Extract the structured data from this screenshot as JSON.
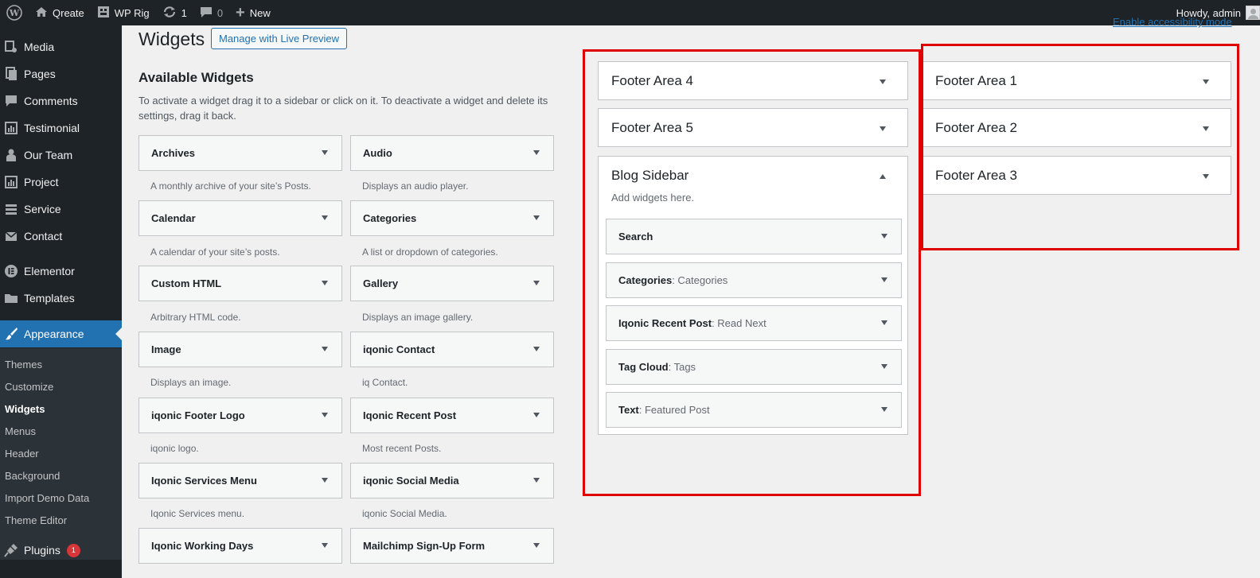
{
  "adminbar": {
    "site_name": "Qreate",
    "theme_name": "WP Rig",
    "updates_count": "1",
    "comments_count": "0",
    "new_label": "New",
    "howdy": "Howdy, admin"
  },
  "sidebar": {
    "items": [
      {
        "label": "Media",
        "icon": "media-icon"
      },
      {
        "label": "Pages",
        "icon": "pages-icon"
      },
      {
        "label": "Comments",
        "icon": "comments-icon"
      },
      {
        "label": "Testimonial",
        "icon": "testimonial-icon"
      },
      {
        "label": "Our Team",
        "icon": "team-icon"
      },
      {
        "label": "Project",
        "icon": "project-icon"
      },
      {
        "label": "Service",
        "icon": "service-icon"
      },
      {
        "label": "Contact",
        "icon": "mail-icon"
      },
      {
        "label": "Elementor",
        "icon": "elementor-icon"
      },
      {
        "label": "Templates",
        "icon": "folder-icon"
      },
      {
        "label": "Appearance",
        "icon": "paintbrush-icon"
      },
      {
        "label": "Plugins",
        "icon": "plugin-icon",
        "badge": "1"
      }
    ],
    "submenu": [
      "Themes",
      "Customize",
      "Widgets",
      "Menus",
      "Header",
      "Background",
      "Import Demo Data",
      "Theme Editor"
    ]
  },
  "header": {
    "title": "Widgets",
    "live_preview": "Manage with Live Preview",
    "accessibility_link": "Enable accessibility mode"
  },
  "available": {
    "title": "Available Widgets",
    "description": "To activate a widget drag it to a sidebar or click on it. To deactivate a widget and delete its settings, drag it back.",
    "widgets": [
      {
        "name": "Archives",
        "desc": "A monthly archive of your site’s Posts."
      },
      {
        "name": "Audio",
        "desc": "Displays an audio player."
      },
      {
        "name": "Calendar",
        "desc": "A calendar of your site’s posts."
      },
      {
        "name": "Categories",
        "desc": "A list or dropdown of categories."
      },
      {
        "name": "Custom HTML",
        "desc": "Arbitrary HTML code."
      },
      {
        "name": "Gallery",
        "desc": "Displays an image gallery."
      },
      {
        "name": "Image",
        "desc": "Displays an image."
      },
      {
        "name": "iqonic Contact",
        "desc": "iq Contact."
      },
      {
        "name": "iqonic Footer Logo",
        "desc": "iqonic logo."
      },
      {
        "name": "Iqonic Recent Post",
        "desc": "Most recent Posts."
      },
      {
        "name": "Iqonic Services Menu",
        "desc": "Iqonic Services menu."
      },
      {
        "name": "iqonic Social Media",
        "desc": "iqonic Social Media."
      },
      {
        "name": "Iqonic Working Days",
        "desc": ""
      },
      {
        "name": "Mailchimp Sign-Up Form",
        "desc": ""
      }
    ]
  },
  "areas": {
    "footer4": "Footer Area 4",
    "footer5": "Footer Area 5",
    "blog_sidebar": "Blog Sidebar",
    "blog_sidebar_desc": "Add widgets here.",
    "footer1": "Footer Area 1",
    "footer2": "Footer Area 2",
    "footer3": "Footer Area 3",
    "blog_widgets": [
      {
        "name": "Search",
        "title": ""
      },
      {
        "name": "Categories",
        "title": ": Categories"
      },
      {
        "name": "Iqonic Recent Post",
        "title": ": Read Next"
      },
      {
        "name": "Tag Cloud",
        "title": ": Tags"
      },
      {
        "name": "Text",
        "title": ": Featured Post"
      }
    ]
  },
  "colors": {
    "accent": "#2271b1",
    "highlight_box": "#e00000",
    "adminbar": "#1d2327"
  }
}
